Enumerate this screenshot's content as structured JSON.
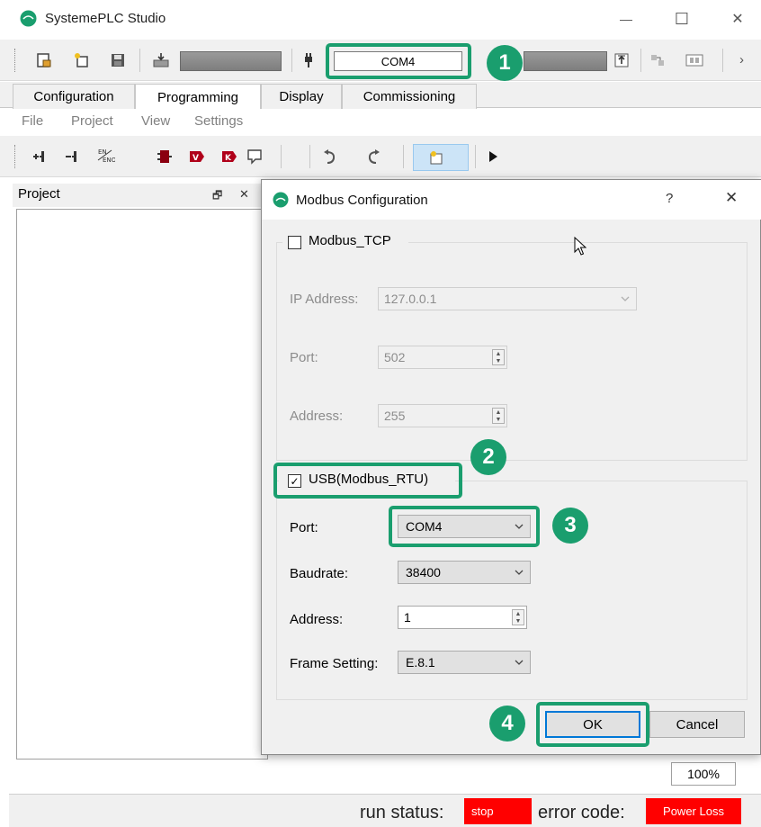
{
  "window": {
    "title": "SystemePLC Studio",
    "minimize": "—",
    "maximize": "☐",
    "close": "✕"
  },
  "toolbar": {
    "com_port": "COM4",
    "overflow": "›"
  },
  "tabs": [
    {
      "label": "Configuration"
    },
    {
      "label": "Programming"
    },
    {
      "label": "Display"
    },
    {
      "label": "Commissioning"
    }
  ],
  "menu": {
    "file": "File",
    "project": "Project",
    "view": "View",
    "settings": "Settings"
  },
  "project_pane": {
    "title": "Project",
    "pin": "🗗",
    "close": "✕"
  },
  "dialog": {
    "title": "Modbus Configuration",
    "help": "?",
    "close": "✕",
    "tcp": {
      "label": "Modbus_TCP",
      "checked": false,
      "ip_label": "IP Address:",
      "ip_value": "127.0.0.1",
      "port_label": "Port:",
      "port_value": "502",
      "address_label": "Address:",
      "address_value": "255"
    },
    "rtu": {
      "label": "USB(Modbus_RTU)",
      "checked": true,
      "checkmark": "✓",
      "port_label": "Port:",
      "port_value": "COM4",
      "baud_label": "Baudrate:",
      "baud_value": "38400",
      "address_label": "Address:",
      "address_value": "1",
      "frame_label": "Frame Setting:",
      "frame_value": "E.8.1"
    },
    "ok_label": "OK",
    "cancel_label": "Cancel"
  },
  "callouts": [
    "1",
    "2",
    "3",
    "4"
  ],
  "zoom": "100%",
  "status": {
    "run_label": "run status:",
    "run_value": "stop",
    "error_label": "error code:",
    "error_value": "Power Loss"
  },
  "colors": {
    "callout_green": "#1a9e6e",
    "status_red": "#ff0000",
    "focus_blue": "#0078d7"
  }
}
